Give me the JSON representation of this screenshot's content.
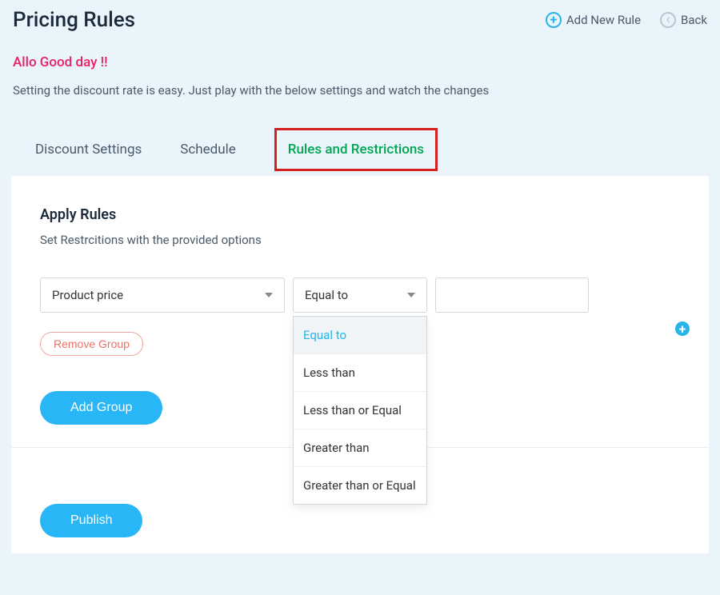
{
  "header": {
    "title": "Pricing Rules",
    "addNew": "Add New Rule",
    "back": "Back"
  },
  "greeting": "Allo Good day !!",
  "subtext": "Setting the discount rate is easy. Just play with the below settings and watch the changes",
  "tabs": {
    "discount": "Discount Settings",
    "schedule": "Schedule",
    "rules": "Rules and Restrictions"
  },
  "section": {
    "title": "Apply Rules",
    "sub": "Set Restrcitions with the provided options"
  },
  "rule": {
    "field": "Product price",
    "operator": "Equal to",
    "value": ""
  },
  "operator_options": [
    "Equal to",
    "Less than",
    "Less than or Equal",
    "Greater than",
    "Greater than or Equal"
  ],
  "buttons": {
    "removeGroup": "Remove Group",
    "addGroup": "Add Group",
    "publish": "Publish"
  }
}
